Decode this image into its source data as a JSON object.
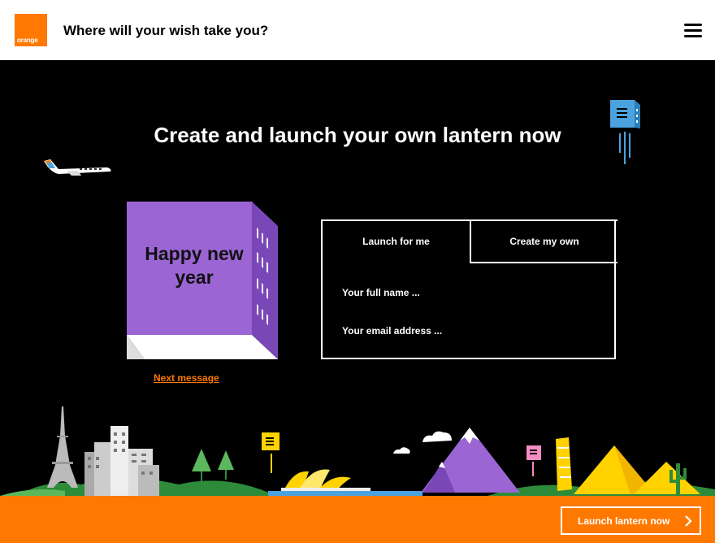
{
  "header": {
    "logo_text": "orange",
    "title": "Where will your wish take you?",
    "menu_icon": "hamburger-menu-icon"
  },
  "hero": {
    "title": "Create and launch your own lantern now"
  },
  "lantern_card": {
    "message": "Happy new year",
    "next_label": "Next message",
    "color": "#9b65d4"
  },
  "form": {
    "tabs": [
      {
        "label": "Launch for me",
        "active": true
      },
      {
        "label": "Create my own",
        "active": false
      }
    ],
    "fields": [
      {
        "placeholder": "Your full name ...",
        "value": ""
      },
      {
        "placeholder": "Your email address ...",
        "value": ""
      }
    ]
  },
  "footer": {
    "cta_label": "Launch lantern now",
    "cta_icon": "chevron-right-icon"
  },
  "colors": {
    "brand": "#ff7900",
    "background": "#000000",
    "lantern": "#9b65d4"
  }
}
